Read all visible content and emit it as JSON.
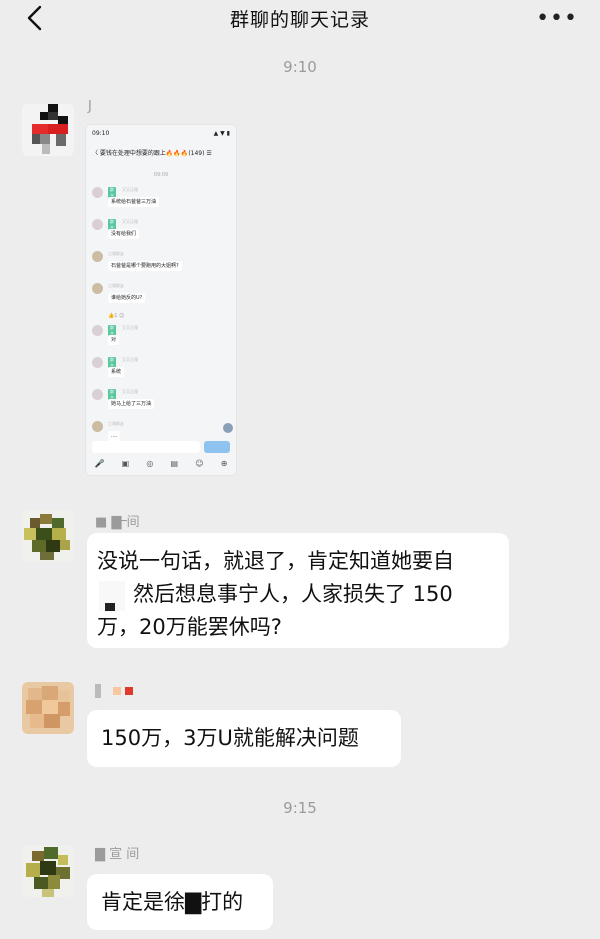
{
  "header": {
    "title": "群聊的聊天记录",
    "more": "•••"
  },
  "times": [
    "9:10",
    "9:15"
  ],
  "messages": [
    {
      "sender": "J",
      "type": "image"
    },
    {
      "sender": "■ ▇᠆间",
      "text_lines": [
        "没说一句话，就退了，肯定知道她要自",
        "然后想息事宁人，人家损失了 150",
        "万，20万能罢休吗?"
      ]
    },
    {
      "sender": "",
      "text": "150万，3万U就能解决问题"
    },
    {
      "sender": "▇ 宣 间",
      "text": "肯定是徐▇打的"
    }
  ],
  "embedded_screenshot": {
    "status_time": "09:10",
    "status_right": "▲ ▼ ▮",
    "title": "〈 要钱在处理中想要的跟上🔥🔥🔥(149) ☰",
    "time": "09:09",
    "rows": [
      {
        "tag": "群主",
        "label": "又又正理",
        "msg": "系统给石爸爸三万油"
      },
      {
        "tag": "群主",
        "label": "又又正理",
        "msg": "没有给我们"
      },
      {
        "tag": "",
        "label": "江湖群友",
        "msg": "石爸爸是哪个要跑用的大姐啊?"
      },
      {
        "tag": "",
        "label": "江湖群友",
        "msg": "谁给她反的U?"
      },
      {
        "tag": "群主",
        "label": "又又正理",
        "msg": "对"
      },
      {
        "tag": "群主",
        "label": "又又正理",
        "msg": "系统"
      },
      {
        "tag": "群主",
        "label": "又又正理",
        "msg": "她马上给了三万油"
      },
      {
        "tag": "",
        "label": "江湖群友",
        "msg": "...."
      }
    ],
    "reaction": "👍1  ☺",
    "tools": [
      "🎤",
      "▣",
      "◎",
      "▤",
      "☺",
      "⊕"
    ]
  },
  "colors": {
    "bg": "#ededed",
    "bubble": "#ffffff",
    "accent": "#5bc7a0"
  }
}
